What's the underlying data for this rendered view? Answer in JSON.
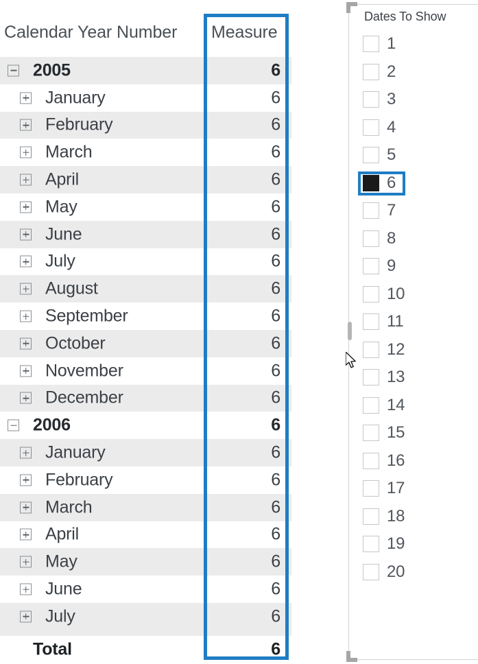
{
  "matrix": {
    "columns": [
      "Calendar Year Number",
      "Measure"
    ],
    "header": {
      "row_label": "Calendar Year Number",
      "measure_label": "Measure"
    },
    "rows": [
      {
        "level": "year",
        "toggle": "minus",
        "label": "2005",
        "value": "6"
      },
      {
        "level": "month",
        "toggle": "plus",
        "label": "January",
        "value": "6"
      },
      {
        "level": "month",
        "toggle": "plus",
        "label": "February",
        "value": "6"
      },
      {
        "level": "month",
        "toggle": "plus",
        "label": "March",
        "value": "6"
      },
      {
        "level": "month",
        "toggle": "plus",
        "label": "April",
        "value": "6"
      },
      {
        "level": "month",
        "toggle": "plus",
        "label": "May",
        "value": "6"
      },
      {
        "level": "month",
        "toggle": "plus",
        "label": "June",
        "value": "6"
      },
      {
        "level": "month",
        "toggle": "plus",
        "label": "July",
        "value": "6"
      },
      {
        "level": "month",
        "toggle": "plus",
        "label": "August",
        "value": "6"
      },
      {
        "level": "month",
        "toggle": "plus",
        "label": "September",
        "value": "6"
      },
      {
        "level": "month",
        "toggle": "plus",
        "label": "October",
        "value": "6"
      },
      {
        "level": "month",
        "toggle": "plus",
        "label": "November",
        "value": "6"
      },
      {
        "level": "month",
        "toggle": "plus",
        "label": "December",
        "value": "6"
      },
      {
        "level": "year",
        "toggle": "minus",
        "label": "2006",
        "value": "6"
      },
      {
        "level": "month",
        "toggle": "plus",
        "label": "January",
        "value": "6"
      },
      {
        "level": "month",
        "toggle": "plus",
        "label": "February",
        "value": "6"
      },
      {
        "level": "month",
        "toggle": "plus",
        "label": "March",
        "value": "6"
      },
      {
        "level": "month",
        "toggle": "plus",
        "label": "April",
        "value": "6"
      },
      {
        "level": "month",
        "toggle": "plus",
        "label": "May",
        "value": "6"
      },
      {
        "level": "month",
        "toggle": "plus",
        "label": "June",
        "value": "6"
      },
      {
        "level": "month",
        "toggle": "plus",
        "label": "July",
        "value": "6"
      }
    ],
    "total": {
      "level": "total",
      "label": "Total",
      "value": "6"
    },
    "selection_color": "#1f7dc4",
    "header_rule_color": "#2c8fd6",
    "band_color": "#ebebeb"
  },
  "slicer": {
    "title": "Dates To Show",
    "items": [
      {
        "label": "1",
        "checked": false
      },
      {
        "label": "2",
        "checked": false
      },
      {
        "label": "3",
        "checked": false
      },
      {
        "label": "4",
        "checked": false
      },
      {
        "label": "5",
        "checked": false
      },
      {
        "label": "6",
        "checked": true
      },
      {
        "label": "7",
        "checked": false
      },
      {
        "label": "8",
        "checked": false
      },
      {
        "label": "9",
        "checked": false
      },
      {
        "label": "10",
        "checked": false
      },
      {
        "label": "11",
        "checked": false
      },
      {
        "label": "12",
        "checked": false
      },
      {
        "label": "13",
        "checked": false
      },
      {
        "label": "14",
        "checked": false
      },
      {
        "label": "15",
        "checked": false
      },
      {
        "label": "16",
        "checked": false
      },
      {
        "label": "17",
        "checked": false
      },
      {
        "label": "18",
        "checked": false
      },
      {
        "label": "19",
        "checked": false
      },
      {
        "label": "20",
        "checked": false
      }
    ],
    "focused_item": "6",
    "focus_color": "#1f7dc4",
    "checked_fill": "#1a1a1a"
  },
  "chart_data": {
    "type": "table",
    "title": "Calendar Year Number by Measure",
    "columns": [
      "Calendar Year Number",
      "Measure"
    ],
    "rows": [
      [
        "2005",
        6
      ],
      [
        "January",
        6
      ],
      [
        "February",
        6
      ],
      [
        "March",
        6
      ],
      [
        "April",
        6
      ],
      [
        "May",
        6
      ],
      [
        "June",
        6
      ],
      [
        "July",
        6
      ],
      [
        "August",
        6
      ],
      [
        "September",
        6
      ],
      [
        "October",
        6
      ],
      [
        "November",
        6
      ],
      [
        "December",
        6
      ],
      [
        "2006",
        6
      ],
      [
        "January",
        6
      ],
      [
        "February",
        6
      ],
      [
        "March",
        6
      ],
      [
        "April",
        6
      ],
      [
        "May",
        6
      ],
      [
        "June",
        6
      ],
      [
        "July",
        6
      ],
      [
        "Total",
        6
      ]
    ]
  }
}
